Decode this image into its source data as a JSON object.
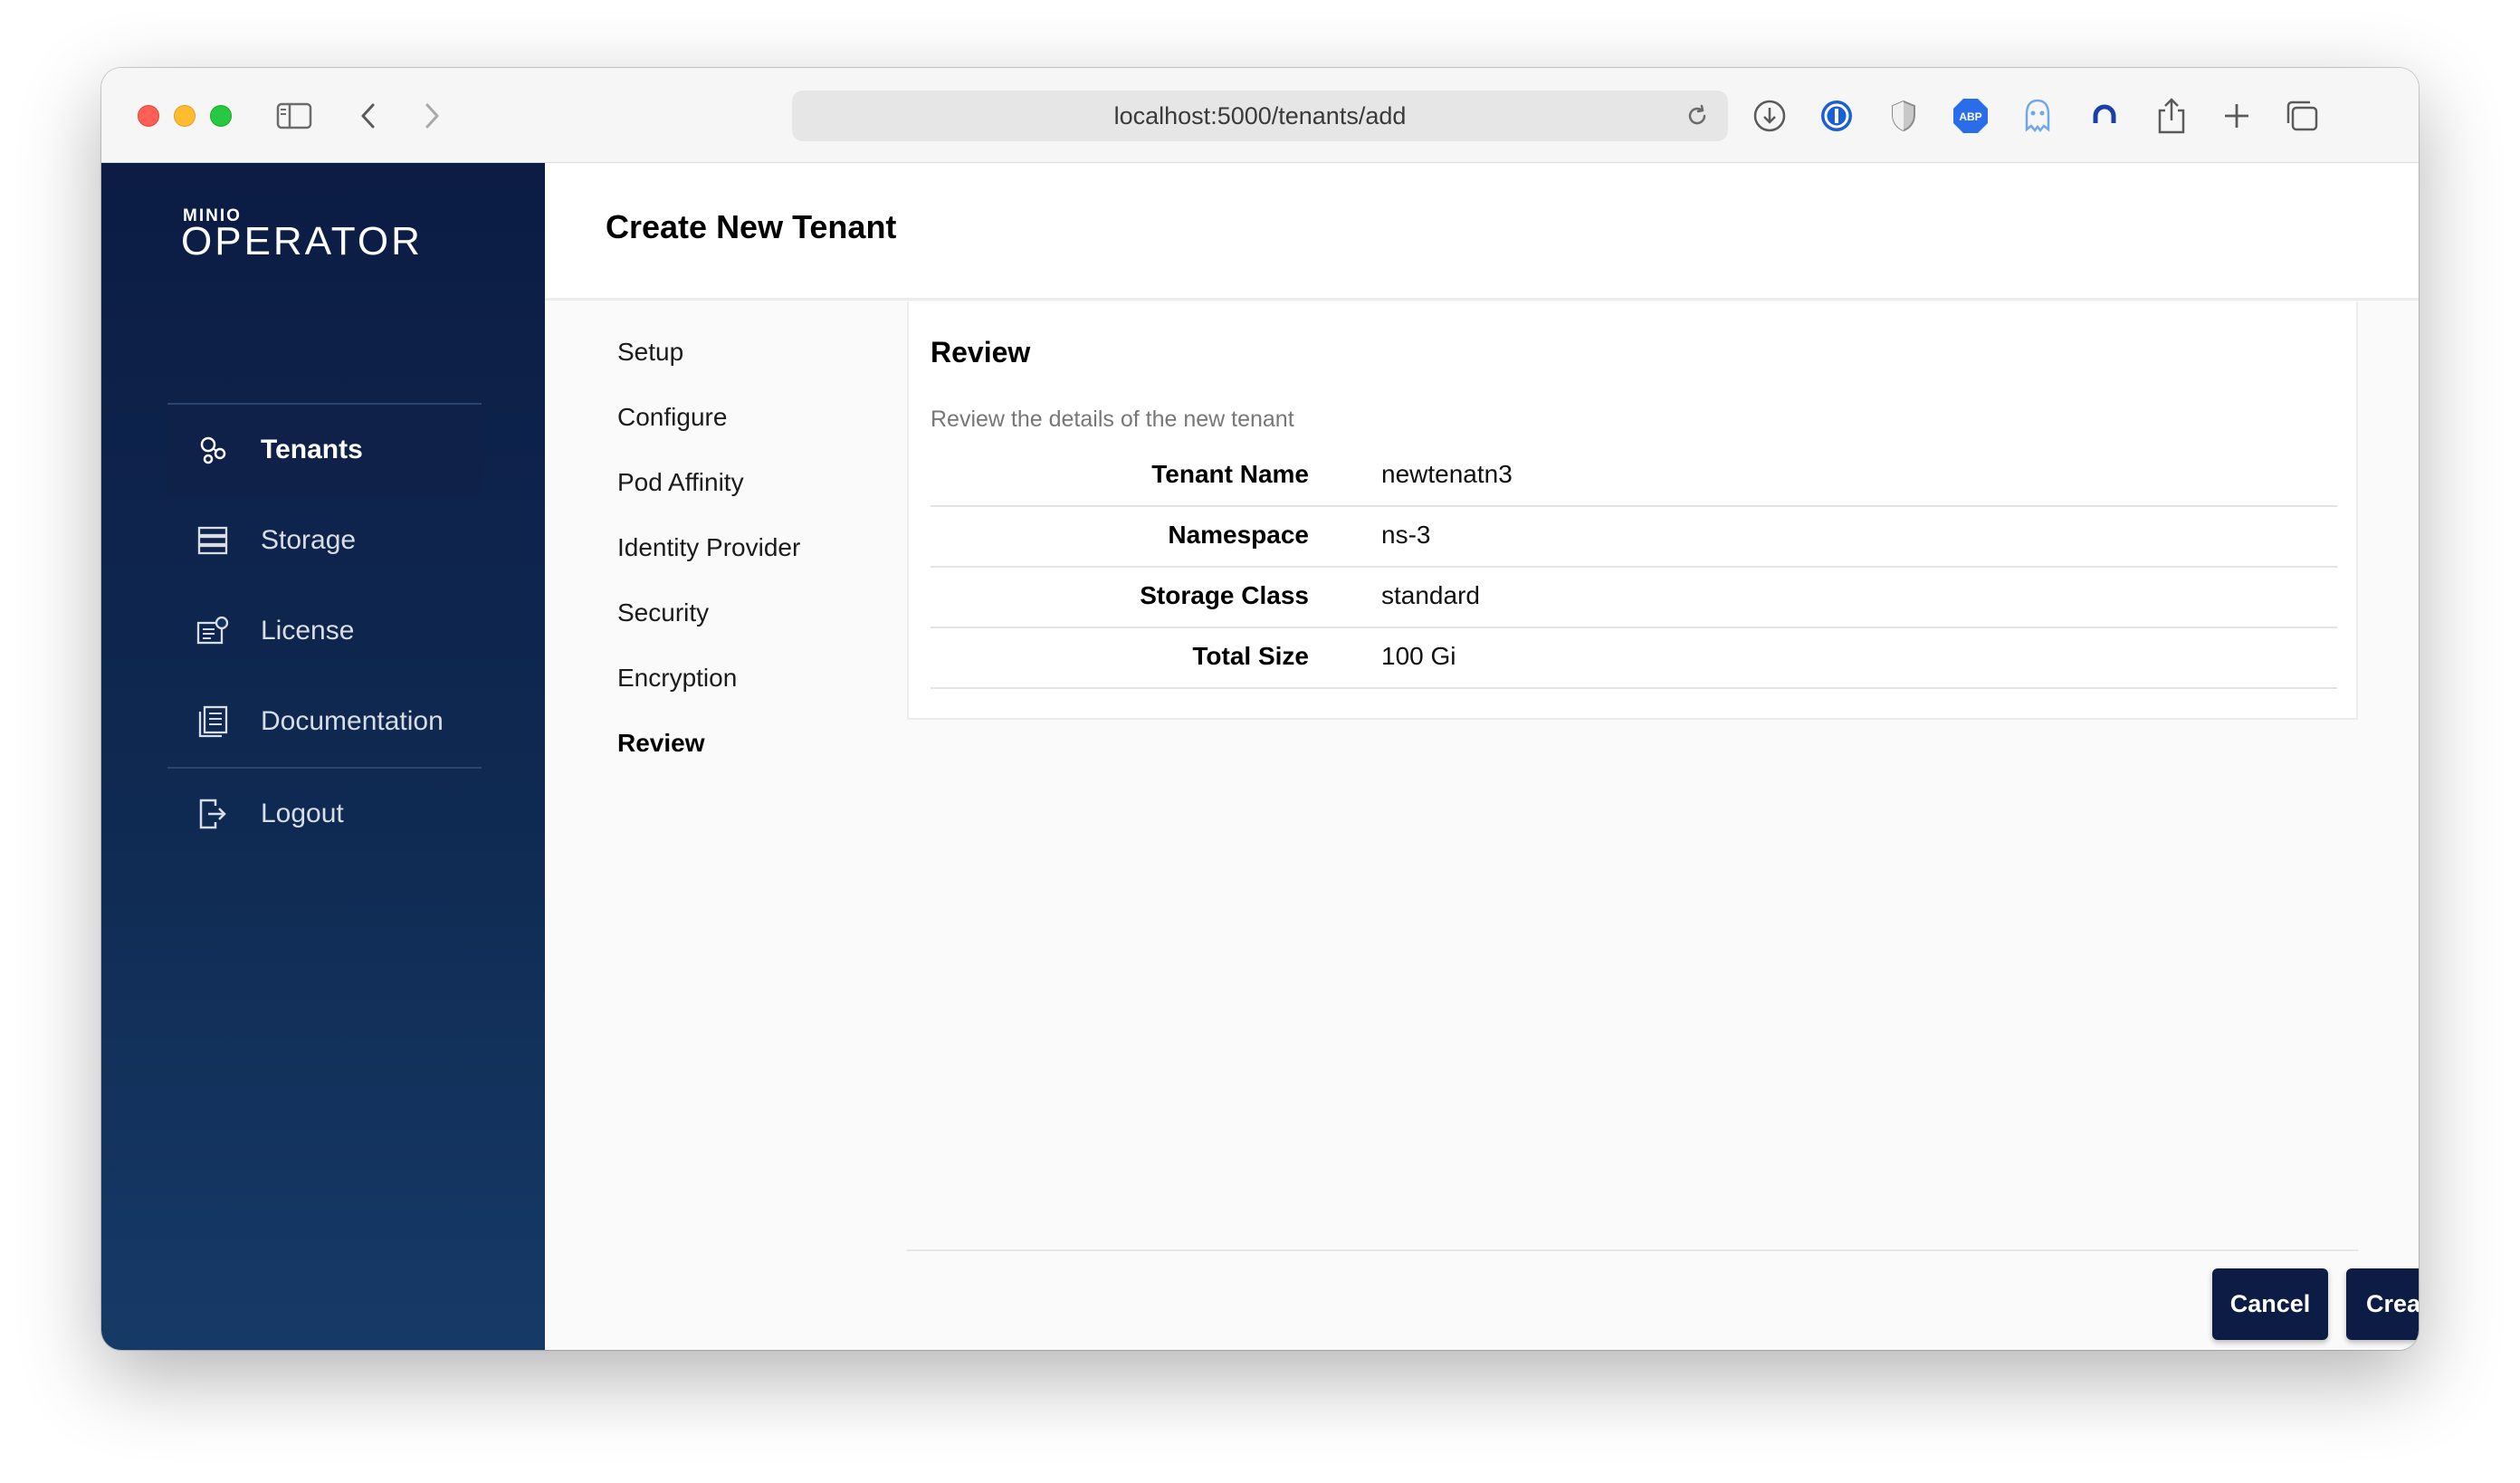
{
  "browser": {
    "url": "localhost:5000/tenants/add",
    "toolbar_icons": [
      "sidebar-toggle-icon",
      "back-arrow-icon",
      "forward-arrow-icon",
      "reload-icon",
      "download-icon",
      "password-manager-icon",
      "shield-icon",
      "adblock-icon",
      "ghostery-icon",
      "extension-icon",
      "share-icon",
      "new-tab-icon",
      "tabs-overview-icon"
    ],
    "adblock_label": "ABP"
  },
  "sidebar": {
    "logo_small": "MINIO",
    "logo_big": "OPERATOR",
    "items": [
      {
        "label": "Tenants",
        "icon": "tenants-icon",
        "active": true
      },
      {
        "label": "Storage",
        "icon": "storage-icon",
        "active": false
      },
      {
        "label": "License",
        "icon": "license-icon",
        "active": false
      },
      {
        "label": "Documentation",
        "icon": "documentation-icon",
        "active": false
      },
      {
        "label": "Logout",
        "icon": "logout-icon",
        "active": false
      }
    ]
  },
  "header": {
    "title": "Create New Tenant"
  },
  "wizard": {
    "steps": [
      "Setup",
      "Configure",
      "Pod Affinity",
      "Identity Provider",
      "Security",
      "Encryption",
      "Review"
    ],
    "current_step": "Review"
  },
  "review": {
    "title": "Review",
    "subtitle": "Review the details of the new tenant",
    "rows": [
      {
        "label": "Tenant Name",
        "value": "newtenatn3"
      },
      {
        "label": "Namespace",
        "value": "ns-3"
      },
      {
        "label": "Storage Class",
        "value": "standard"
      },
      {
        "label": "Total Size",
        "value": "100 Gi"
      }
    ]
  },
  "actions": {
    "cancel_label": "Cancel",
    "create_label": "Create"
  },
  "colors": {
    "sidebar_bg": "#0c1c44",
    "button_bg": "#0c1c44",
    "traffic_red": "#ff5f57",
    "traffic_yellow": "#febc2e",
    "traffic_green": "#28c840",
    "adblock_red": "#2b6de8"
  }
}
